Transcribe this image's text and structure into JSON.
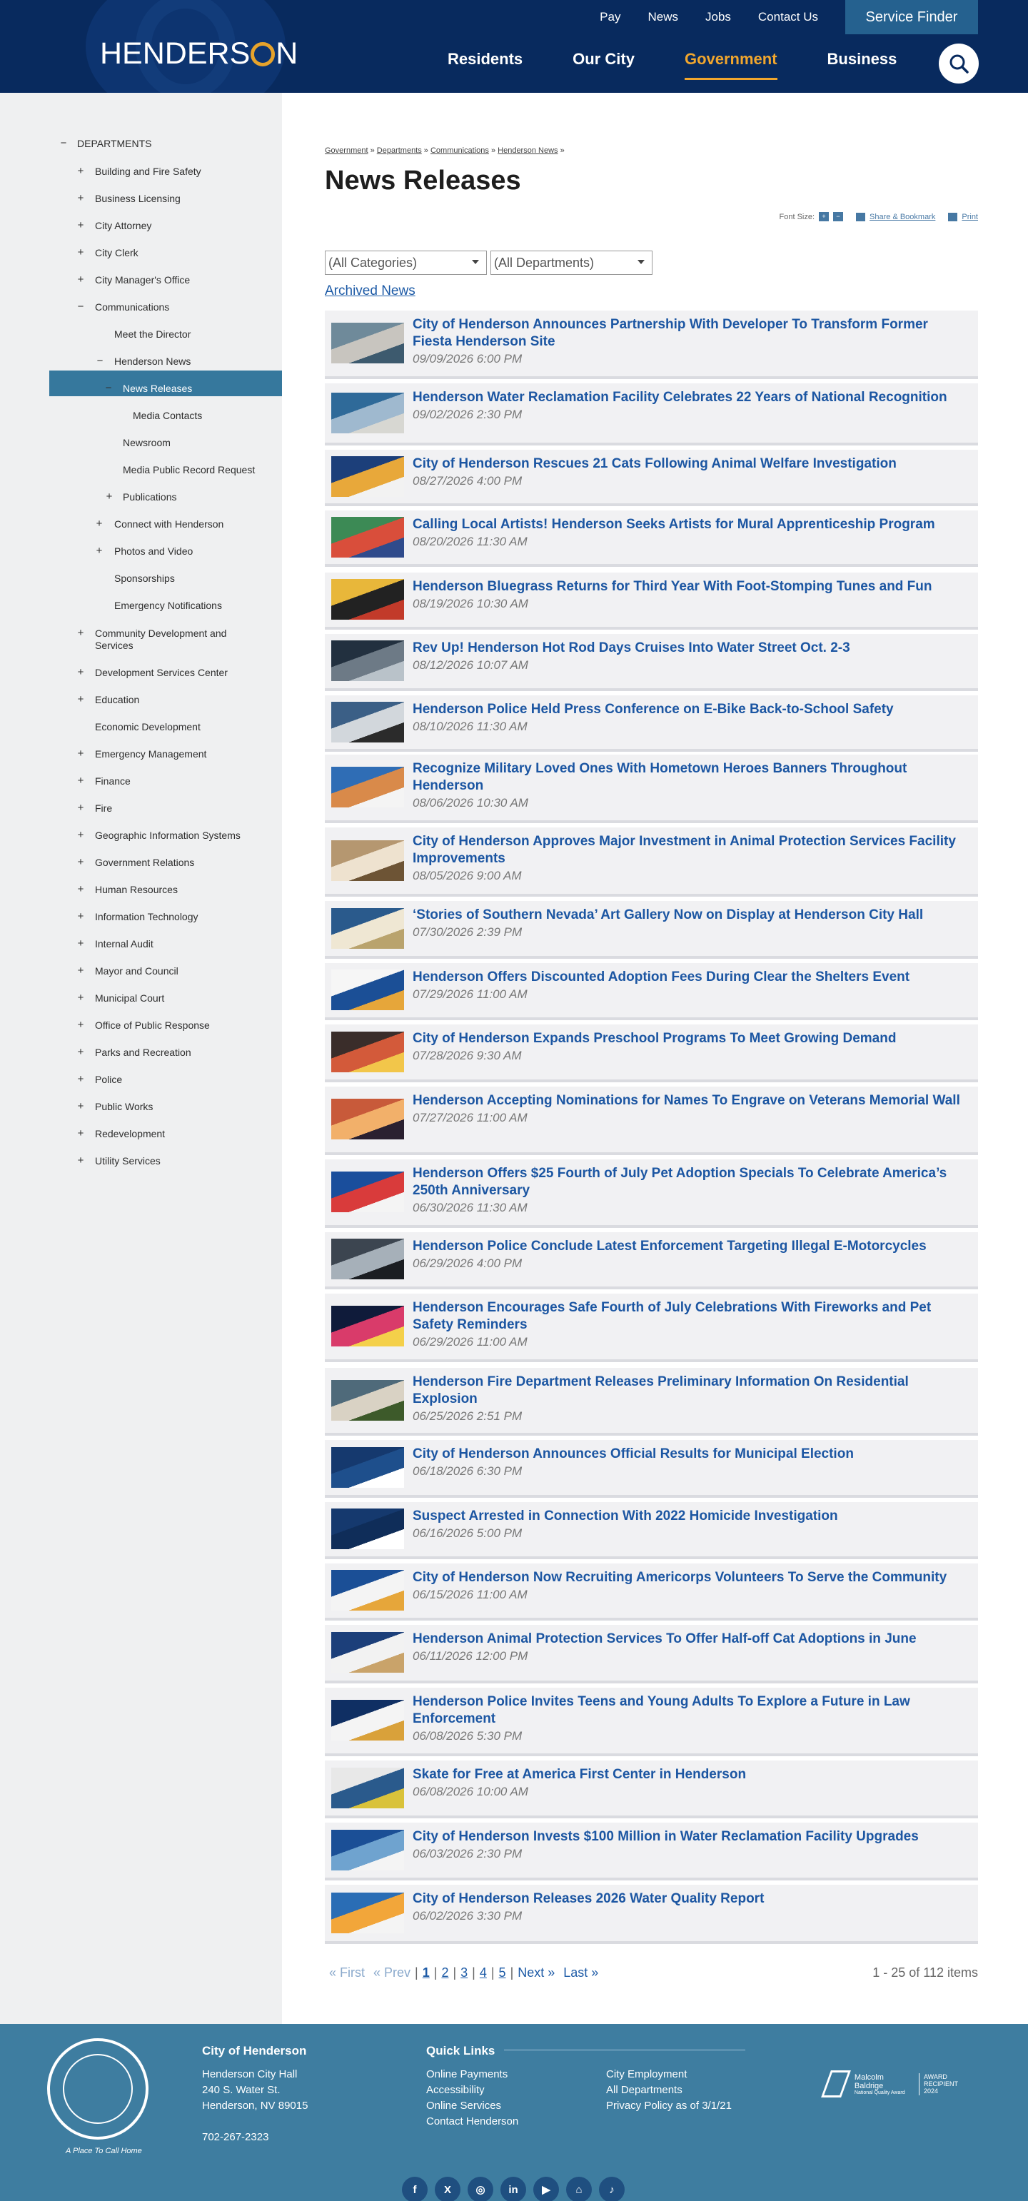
{
  "header": {
    "brand": {
      "before": "HENDERS",
      "after": "N"
    },
    "utility": [
      "Pay",
      "News",
      "Jobs",
      "Contact Us"
    ],
    "service_finder": "Service Finder",
    "nav": [
      "Residents",
      "Our City",
      "Government",
      "Business"
    ],
    "active_nav": "Government"
  },
  "sidebar": {
    "items": [
      {
        "label": "DEPARTMENTS",
        "exp": "−"
      },
      {
        "label": "Building and Fire Safety",
        "exp": "+"
      },
      {
        "label": "Business Licensing",
        "exp": "+"
      },
      {
        "label": "City Attorney",
        "exp": "+"
      },
      {
        "label": "City Clerk",
        "exp": "+"
      },
      {
        "label": "City Manager's Office",
        "exp": "+"
      },
      {
        "label": "Communications",
        "exp": "−"
      },
      {
        "label": "Meet the Director",
        "exp": ""
      },
      {
        "label": "Henderson News",
        "exp": "−"
      },
      {
        "label": "News Releases",
        "exp": "−"
      },
      {
        "label": "Media Contacts",
        "exp": ""
      },
      {
        "label": "Newsroom",
        "exp": ""
      },
      {
        "label": "Media Public Record Request",
        "exp": ""
      },
      {
        "label": "Publications",
        "exp": "+"
      },
      {
        "label": "Connect with Henderson",
        "exp": "+"
      },
      {
        "label": "Photos and Video",
        "exp": "+"
      },
      {
        "label": "Sponsorships",
        "exp": ""
      },
      {
        "label": "Emergency Notifications",
        "exp": ""
      },
      {
        "label": "Community Development and Services",
        "exp": "+"
      },
      {
        "label": "Development Services Center",
        "exp": "+"
      },
      {
        "label": "Education",
        "exp": "+"
      },
      {
        "label": "Economic Development",
        "exp": ""
      },
      {
        "label": "Emergency Management",
        "exp": "+"
      },
      {
        "label": "Finance",
        "exp": "+"
      },
      {
        "label": "Fire",
        "exp": "+"
      },
      {
        "label": "Geographic Information Systems",
        "exp": "+"
      },
      {
        "label": "Government Relations",
        "exp": "+"
      },
      {
        "label": "Human Resources",
        "exp": "+"
      },
      {
        "label": "Information Technology",
        "exp": "+"
      },
      {
        "label": "Internal Audit",
        "exp": "+"
      },
      {
        "label": "Mayor and Council",
        "exp": "+"
      },
      {
        "label": "Municipal Court",
        "exp": "+"
      },
      {
        "label": "Office of Public Response",
        "exp": "+"
      },
      {
        "label": "Parks and Recreation",
        "exp": "+"
      },
      {
        "label": "Police",
        "exp": "+"
      },
      {
        "label": "Public Works",
        "exp": "+"
      },
      {
        "label": "Redevelopment",
        "exp": "+"
      },
      {
        "label": "Utility Services",
        "exp": "+"
      }
    ]
  },
  "breadcrumb": [
    "Government",
    "Departments",
    "Communications",
    "Henderson News"
  ],
  "page_title": "News Releases",
  "tools": {
    "font_size": "Font Size:",
    "plus": "+",
    "minus": "−",
    "share": "Share & Bookmark",
    "print": "Print"
  },
  "filters": {
    "category": "(All Categories)",
    "department": "(All Departments)"
  },
  "archived": "Archived News",
  "news": [
    {
      "title": "City of Henderson Announces Partnership With Developer To Transform Former Fiesta Henderson Site",
      "date": "09/09/2026 6:00 PM",
      "thumb": "aerial"
    },
    {
      "title": "Henderson Water Reclamation Facility Celebrates 22 Years of National Recognition",
      "date": "09/02/2026 2:30 PM",
      "thumb": "water"
    },
    {
      "title": "City of Henderson Rescues 21 Cats Following Animal Welfare Investigation",
      "date": "08/27/2026 4:00 PM",
      "thumb": "cats"
    },
    {
      "title": "Calling Local Artists! Henderson Seeks Artists for Mural Apprenticeship Program",
      "date": "08/20/2026 11:30 AM",
      "thumb": "mural"
    },
    {
      "title": "Henderson Bluegrass Returns for Third Year With Foot-Stomping Tunes and Fun",
      "date": "08/19/2026 10:30 AM",
      "thumb": "poster"
    },
    {
      "title": "Rev Up! Henderson Hot Rod Days Cruises Into Water Street Oct. 2-3",
      "date": "08/12/2026 10:07 AM",
      "thumb": "car"
    },
    {
      "title": "Henderson Police Held Press Conference on E-Bike Back-to-School Safety",
      "date": "08/10/2026 11:30 AM",
      "thumb": "press"
    },
    {
      "title": "Recognize Military Loved Ones With Hometown Heroes Banners Throughout Henderson",
      "date": "08/06/2026 10:30 AM",
      "thumb": "banner"
    },
    {
      "title": "City of Henderson Approves Major Investment in Animal Protection Services Facility Improvements",
      "date": "08/05/2026 9:00 AM",
      "thumb": "dog"
    },
    {
      "title": "‘Stories of Southern Nevada’ Art Gallery Now on Display at Henderson City Hall",
      "date": "07/30/2026 2:39 PM",
      "thumb": "gallery"
    },
    {
      "title": "Henderson Offers Discounted Adoption Fees During Clear the Shelters Event",
      "date": "07/29/2026 11:00 AM",
      "thumb": "adopt"
    },
    {
      "title": "City of Henderson Expands Preschool Programs To Meet Growing Demand",
      "date": "07/28/2026 9:30 AM",
      "thumb": "kids"
    },
    {
      "title": "Henderson Accepting Nominations for Names To Engrave on Veterans Memorial Wall",
      "date": "07/27/2026 11:00 AM",
      "thumb": "sunset"
    },
    {
      "title": "Henderson Offers $25 Fourth of July Pet Adoption Specials To Celebrate America’s 250th Anniversary",
      "date": "06/30/2026 11:30 AM",
      "thumb": "july"
    },
    {
      "title": "Henderson Police Conclude Latest Enforcement Targeting Illegal E-Motorcycles",
      "date": "06/29/2026 4:00 PM",
      "thumb": "moto"
    },
    {
      "title": "Henderson Encourages Safe Fourth of July Celebrations With Fireworks and Pet Safety Reminders",
      "date": "06/29/2026 11:00 AM",
      "thumb": "fireworks"
    },
    {
      "title": "Henderson Fire Department Releases Preliminary Information On Residential Explosion",
      "date": "06/25/2026 2:51 PM",
      "thumb": "house"
    },
    {
      "title": "City of Henderson Announces Official Results for Municipal Election",
      "date": "06/18/2026 6:30 PM",
      "thumb": "logo"
    },
    {
      "title": "Suspect Arrested in Connection With 2022 Homicide Investigation",
      "date": "06/16/2026 5:00 PM",
      "thumb": "logo2"
    },
    {
      "title": "City of Henderson Now Recruiting Americorps Volunteers To Serve the Community",
      "date": "06/15/2026 11:00 AM",
      "thumb": "volunteer"
    },
    {
      "title": "Henderson Animal Protection Services To Offer Half-off Cat Adoptions in June",
      "date": "06/11/2026 12:00 PM",
      "thumb": "catad"
    },
    {
      "title": "Henderson Police Invites Teens and Young Adults To Explore a Future in Law Enforcement",
      "date": "06/08/2026 5:30 PM",
      "thumb": "police"
    },
    {
      "title": "Skate for Free at America First Center in Henderson",
      "date": "06/08/2026 10:00 AM",
      "thumb": "skate"
    },
    {
      "title": "City of Henderson Invests $100 Million in Water Reclamation Facility Upgrades",
      "date": "06/03/2026 2:30 PM",
      "thumb": "invest"
    },
    {
      "title": "City of Henderson Releases 2026 Water Quality Report",
      "date": "06/02/2026 3:30 PM",
      "thumb": "report"
    }
  ],
  "pager": {
    "first": "« First",
    "prev": "« Prev",
    "pages": [
      "1",
      "2",
      "3",
      "4",
      "5"
    ],
    "current": "1",
    "next": "Next »",
    "last": "Last »",
    "count": "1 - 25 of 112 items"
  },
  "footer": {
    "tagline": "A Place To Call Home",
    "city_heading": "City of Henderson",
    "address": [
      "Henderson City Hall",
      "240 S. Water St.",
      "Henderson, NV 89015"
    ],
    "phone": "702-267-2323",
    "quick_heading": "Quick Links",
    "links_col1": [
      "Online Payments",
      "Accessibility",
      "Online Services",
      "Contact Henderson"
    ],
    "links_col2": [
      "City Employment",
      "All Departments",
      "Privacy Policy as of 3/1/21"
    ],
    "award": {
      "line1": "Malcolm Baldrige",
      "line2": "National Quality Award",
      "line3": "AWARD RECIPIENT",
      "line4": "2024"
    },
    "social": [
      {
        "name": "facebook-icon",
        "glyph": "f"
      },
      {
        "name": "x-icon",
        "glyph": "X"
      },
      {
        "name": "instagram-icon",
        "glyph": "◎"
      },
      {
        "name": "linkedin-icon",
        "glyph": "in"
      },
      {
        "name": "youtube-icon",
        "glyph": "▶"
      },
      {
        "name": "nextdoor-icon",
        "glyph": "⌂"
      },
      {
        "name": "tiktok-icon",
        "glyph": "♪"
      }
    ]
  },
  "colors": {
    "navy": "#082a5e",
    "accent": "#f0a62e",
    "link": "#1c56a2",
    "active": "#36789d",
    "footer": "#3e7da0"
  }
}
